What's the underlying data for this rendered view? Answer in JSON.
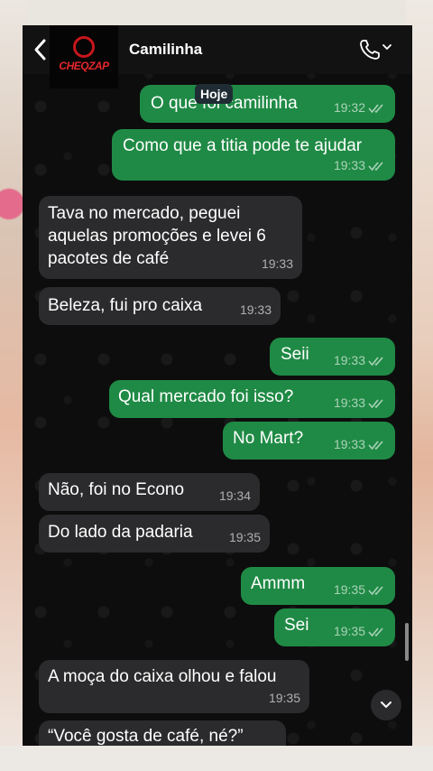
{
  "header": {
    "contact_name": "Camilinha",
    "logo_text": "CHEQZAP"
  },
  "date_chip": "Hoje",
  "messages": [
    {
      "dir": "out",
      "text": "O que foi camilinha",
      "time": "19:32"
    },
    {
      "dir": "out",
      "text": "Como que a titia pode te ajudar",
      "time": "19:33"
    },
    {
      "dir": "in",
      "text": "Tava no mercado, peguei aquelas promoções e levei 6 pacotes de café",
      "time": "19:33"
    },
    {
      "dir": "in",
      "text": "Beleza, fui pro caixa",
      "time": "19:33"
    },
    {
      "dir": "out",
      "text": "Seii",
      "time": "19:33"
    },
    {
      "dir": "out",
      "text": "Qual mercado foi isso?",
      "time": "19:33"
    },
    {
      "dir": "out",
      "text": "No Mart?",
      "time": "19:33"
    },
    {
      "dir": "in",
      "text": "Não, foi no Econo",
      "time": "19:34"
    },
    {
      "dir": "in",
      "text": "Do lado da padaria",
      "time": "19:35"
    },
    {
      "dir": "out",
      "text": "Ammm",
      "time": "19:35"
    },
    {
      "dir": "out",
      "text": "Sei",
      "time": "19:35"
    },
    {
      "dir": "in",
      "text": "A moça do caixa olhou e falou",
      "time": "19:35"
    },
    {
      "dir": "in",
      "text": "“Você gosta de café, né?”",
      "time": ""
    }
  ],
  "colors": {
    "outgoing_bubble": "#1f8a45",
    "incoming_bubble": "#2b2b2d",
    "logo_red": "#e5262c"
  },
  "icons": [
    "back-chevron-icon",
    "phone-icon",
    "chevron-down-icon",
    "double-check-icon",
    "scroll-down-icon"
  ]
}
